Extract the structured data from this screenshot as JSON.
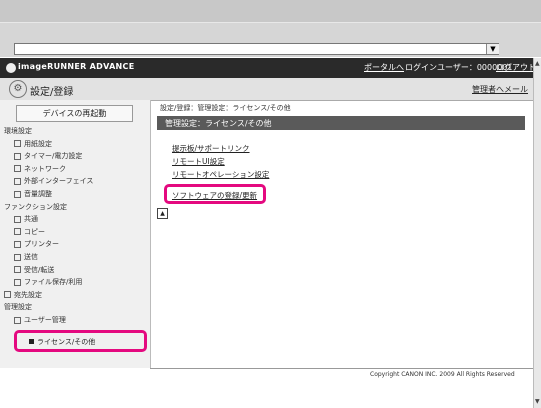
{
  "browser": {
    "dropdown_arrow": "▼"
  },
  "app": {
    "brand": "imageRUNNER ADVANCE",
    "portal_link": "ポータルへ",
    "user_label": "ログインユーザー：0000001",
    "logout_link": "ログアウト"
  },
  "page": {
    "title": "設定/登録",
    "mail_link": "管理者へメール"
  },
  "sidebar": {
    "restart_button": "デバイスの再起動",
    "items": [
      {
        "label": "環境設定",
        "level": 0
      },
      {
        "label": "用紙設定",
        "level": 1
      },
      {
        "label": "タイマー/電力設定",
        "level": 1
      },
      {
        "label": "ネットワーク",
        "level": 1
      },
      {
        "label": "外部インターフェイス",
        "level": 1
      },
      {
        "label": "音量調整",
        "level": 1
      },
      {
        "label": "ファンクション設定",
        "level": 0
      },
      {
        "label": "共通",
        "level": 1
      },
      {
        "label": "コピー",
        "level": 1
      },
      {
        "label": "プリンター",
        "level": 1
      },
      {
        "label": "送信",
        "level": 1
      },
      {
        "label": "受信/転送",
        "level": 1
      },
      {
        "label": "ファイル保存/利用",
        "level": 1
      },
      {
        "label": "宛先設定",
        "level": 0
      },
      {
        "label": "管理設定",
        "level": 0
      },
      {
        "label": "ユーザー管理",
        "level": 1
      }
    ],
    "selected_item": "ライセンス/その他"
  },
  "main": {
    "breadcrumb": "設定/登録：管理設定：ライセンス/その他",
    "section_title": "管理設定：ライセンス/その他",
    "links": [
      "提示板/サポートリンク",
      "リモートUI設定",
      "リモートオペレーション設定",
      "ソフトウェアの登録/更新"
    ],
    "top_icon": "▲"
  },
  "footer": {
    "copyright": "Copyright CANON INC. 2009 All Rights Reserved"
  },
  "accent_color": "#e4097f"
}
